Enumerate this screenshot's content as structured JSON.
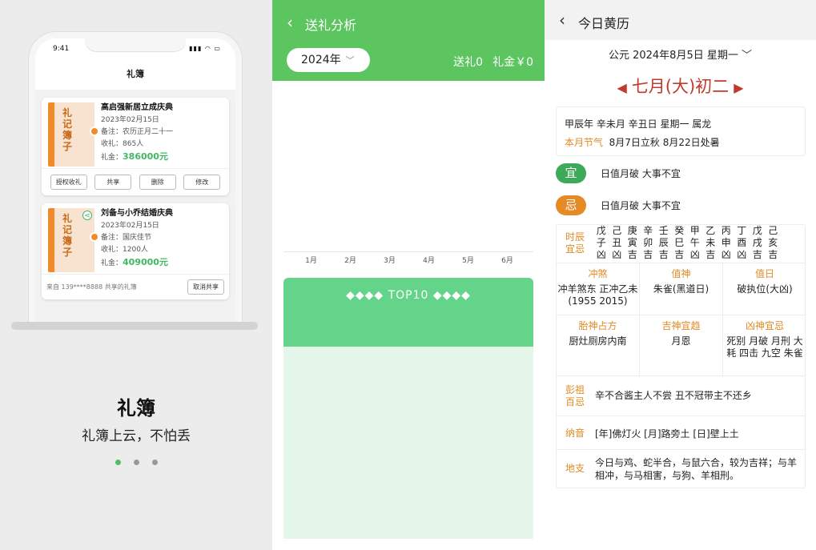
{
  "panel1": {
    "phone": {
      "time": "9:41",
      "title": "礼簿",
      "cards": [
        {
          "book_title": "礼记簿子",
          "name": "高启强新居立成庆典",
          "date": "2023年02月15日",
          "note_label": "备注：",
          "note": "农历正月二十一",
          "gift_label": "收礼：",
          "gift": "865人",
          "amount_label": "礼金：",
          "amount": "386000元",
          "actions": [
            "授权收礼",
            "共享",
            "删除",
            "修改"
          ]
        },
        {
          "book_title": "礼记簿子",
          "name": "刘备与小乔结婚庆典",
          "date": "2023年02月15日",
          "note_label": "备注：",
          "note": "国庆佳节",
          "gift_label": "收礼：",
          "gift": "1200人",
          "amount_label": "礼金：",
          "amount": "409000元",
          "from_text": "来自 139****8888 共享的礼簿",
          "cancel_share": "取消共享"
        }
      ]
    },
    "caption_title": "礼簿",
    "caption_sub": "礼簿上云，不怕丢",
    "pager": {
      "count": 3,
      "active_index": 0
    }
  },
  "panel2": {
    "title": "送礼分析",
    "year": "2024年",
    "sent": "送礼0",
    "money": "礼金￥0",
    "months": [
      "1月",
      "2月",
      "3月",
      "4月",
      "5月",
      "6月"
    ],
    "top10": "◆◆◆◆  TOP10  ◆◆◆◆",
    "accent": "#5cc560"
  },
  "panel3": {
    "title": "今日黄历",
    "date_sel": "公元 2024年8月5日 星期一",
    "lunar": "七月(大)初二",
    "ganzhi": "甲辰年 辛未月 辛丑日 星期一 属龙",
    "jieqi_label": "本月节气",
    "jieqi": "8月7日立秋 8月22日处暑",
    "yi_label": "宜",
    "yi": "日值月破 大事不宜",
    "ji_label": "忌",
    "ji": "日值月破 大事不宜",
    "hours_label": "时辰宜忌",
    "hours": [
      [
        "戊",
        "子",
        "凶"
      ],
      [
        "己",
        "丑",
        "凶"
      ],
      [
        "庚",
        "寅",
        "吉"
      ],
      [
        "辛",
        "卯",
        "吉"
      ],
      [
        "壬",
        "辰",
        "吉"
      ],
      [
        "癸",
        "巳",
        "吉"
      ],
      [
        "甲",
        "午",
        "凶"
      ],
      [
        "乙",
        "未",
        "吉"
      ],
      [
        "丙",
        "申",
        "凶"
      ],
      [
        "丁",
        "酉",
        "凶"
      ],
      [
        "戊",
        "戌",
        "吉"
      ],
      [
        "己",
        "亥",
        "吉"
      ]
    ],
    "chongsha_label": "冲煞",
    "chongsha": "冲羊煞东 正冲乙未(1955 2015)",
    "zhishen_label": "值神",
    "zhishen": "朱雀(黑道日)",
    "zhiri_label": "值日",
    "zhiri": "破执位(大凶)",
    "taishen_label": "胎神占方",
    "taishen": "厨灶厕房内南",
    "jishen_label": "吉神宜趋",
    "jishen": "月恩",
    "xiongshen_label": "凶神宜忌",
    "xiongshen": "死别 月破 月刑 大耗 四击 九空 朱雀",
    "pengzu_label": "彭祖百忌",
    "pengzu": "辛不合酱主人不尝 丑不冠带主不还乡",
    "nayin_label": "纳音",
    "nayin": "[年]佛灯火 [月]路旁土 [日]壁上土",
    "dizhi_label": "地支",
    "dizhi": "今日与鸡、蛇半合，与鼠六合，较为吉祥；与羊相冲，与马相害，与狗、羊相刑。",
    "accent_red": "#c13a2d",
    "accent_orange": "#e08a24"
  }
}
